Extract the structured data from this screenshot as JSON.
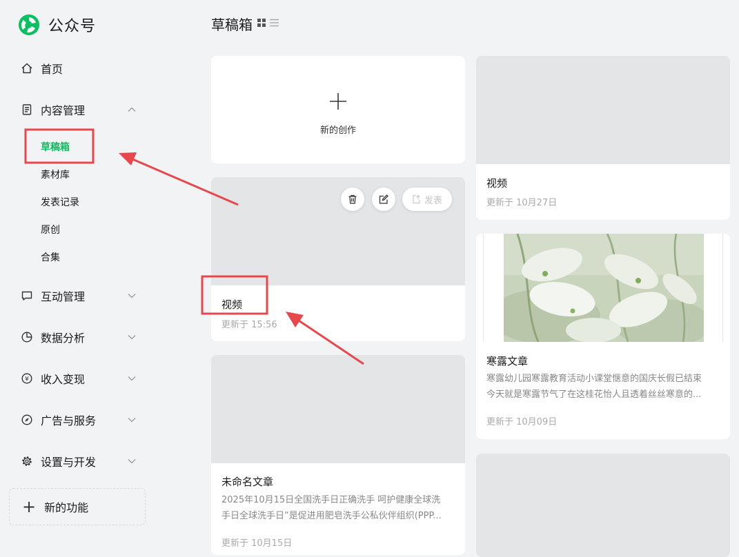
{
  "app": {
    "name": "公众号"
  },
  "sidebar": {
    "home": "首页",
    "content": "内容管理",
    "content_sub": [
      "草稿箱",
      "素材库",
      "发表记录",
      "原创",
      "合集"
    ],
    "interaction": "互动管理",
    "analytics": "数据分析",
    "monetize": "收入变现",
    "ads": "广告与服务",
    "settings": "设置与开发",
    "new_feature": "新的功能"
  },
  "header": {
    "title": "草稿箱"
  },
  "cards": {
    "new": {
      "label": "新的创作"
    },
    "video_today": {
      "title": "视频",
      "meta": "更新于 15:56",
      "publish": "发表"
    },
    "untitled": {
      "title": "未命名文章",
      "desc1": "2025年10月15日全国洗手日正确洗手 呵护健康全球洗",
      "desc2": "手日全球洗手日”是促进用肥皂洗手公私伙伴组织(PPP...",
      "meta": "更新于 10月15日"
    },
    "video_oct27": {
      "title": "视频",
      "meta": "更新于 10月27日"
    },
    "hanlu": {
      "title": "寒露文章",
      "desc1": "寒露幼儿园寒露教育活动小课堂惬意的国庆长假已结束",
      "desc2": "今天就是寒露节气了在这桂花怡人且透着丝丝寒意的...",
      "meta": "更新于 10月09日"
    }
  },
  "colors": {
    "accent": "#07c160",
    "annotation": "#e8474b",
    "background": "#f2f3f5"
  }
}
